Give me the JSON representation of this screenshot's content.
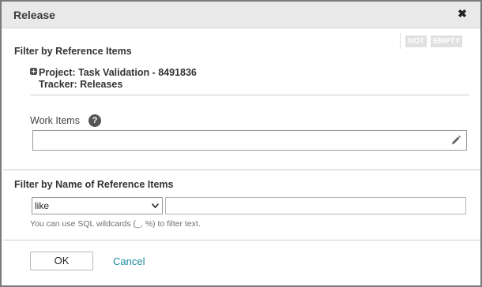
{
  "dialog": {
    "title": "Release",
    "close_icon": "close-icon"
  },
  "filter_reference": {
    "heading": "Filter by Reference Items",
    "not_label": "NOT",
    "empty_label": "EMPTY",
    "project_line": "Project: Task Validation - 8491836",
    "tracker_line": "Tracker: Releases",
    "work_items_label": "Work Items",
    "work_items_value": ""
  },
  "filter_name": {
    "heading": "Filter by Name of Reference Items",
    "operator_selected": "like",
    "filter_text": "",
    "hint": "You can use SQL wildcards (_, %) to filter text."
  },
  "footer": {
    "ok_label": "OK",
    "cancel_label": "Cancel"
  },
  "colors": {
    "titlebar_bg": "#e9e9e9",
    "cancel_link": "#1a8a9a",
    "badge_bg": "#e0e0e0"
  }
}
